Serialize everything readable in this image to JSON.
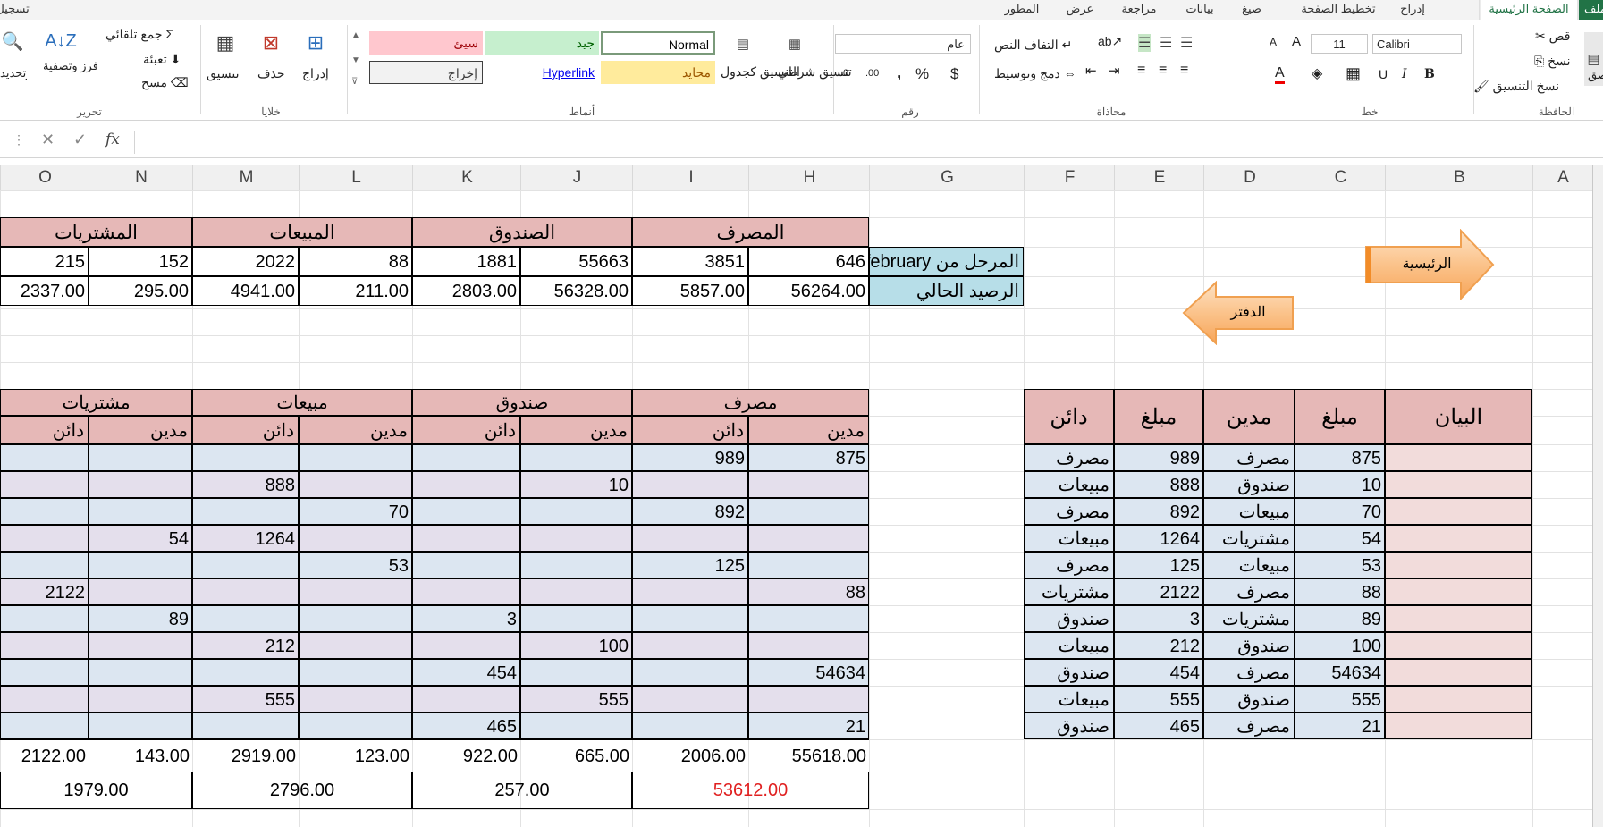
{
  "tabs": [
    "ملف",
    "الصفحة الرئيسية",
    "إدراج",
    "تخطيط الصفحة",
    "صيغ",
    "بيانات",
    "مراجعة",
    "عرض",
    "المطور",
    "تسجيل"
  ],
  "active_tab": "الصفحة الرئيسية",
  "ribbon": {
    "clipboard": {
      "group": "الحافظة",
      "cut": "قص",
      "copy": "نسخ",
      "format_painter": "نسخ التنسيق",
      "paste": "لصق"
    },
    "font": {
      "group": "خط",
      "name": "Calibri",
      "size": "11",
      "bold": "B",
      "italic": "I",
      "underline": "U"
    },
    "alignment": {
      "group": "محاذاة",
      "wrap": "التفاف النص",
      "merge": "دمج وتوسيط"
    },
    "number": {
      "group": "رقم",
      "format": "عام",
      "currency": "$",
      "percent": "%",
      "comma": ","
    },
    "styles": {
      "group": "أنماط",
      "conditional": "تنسيق شرطي",
      "as_table": "التنسيق كجدول",
      "normal": "Normal",
      "good": "جيد",
      "bad": "سيئ",
      "neutral": "محايد",
      "hyperlink": "Hyperlink",
      "output": "إخراج"
    },
    "cells": {
      "group": "خلايا",
      "insert": "إدراج",
      "delete": "حذف",
      "format": "تنسيق"
    },
    "editing": {
      "group": "تحرير",
      "autosum": "جمع تلقائي",
      "fill": "تعبئة",
      "clear": "مسح",
      "sort": "فرز وتصفية",
      "find": "بحث وتحديد"
    }
  },
  "formula_bar": {
    "fx": "fx",
    "content": ""
  },
  "columns": [
    "O",
    "N",
    "M",
    "L",
    "K",
    "J",
    "I",
    "H",
    "G",
    "F",
    "E",
    "D",
    "C",
    "B",
    "A"
  ],
  "shapes": {
    "main_arrow": "الرئيسية",
    "ledger_arrow": "الدفتر"
  },
  "summary": {
    "groups": [
      "المشتريات",
      "المبيعات",
      "الصندوق",
      "المصرف"
    ],
    "carried_label": "المرحل من february",
    "current_label": "الرصيد الحالي",
    "carried": [
      "215",
      "152",
      "2022",
      "88",
      "1881",
      "55663",
      "3851",
      "646"
    ],
    "current": [
      "2337.00",
      "295.00",
      "4941.00",
      "211.00",
      "2803.00",
      "56328.00",
      "5857.00",
      "56264.00"
    ]
  },
  "ledger": {
    "groups": [
      "مشتريات",
      "مبيعات",
      "صندوق",
      "مصرف"
    ],
    "subheaders": [
      "دائن",
      "مدين",
      "دائن",
      "مدين",
      "دائن",
      "مدين",
      "دائن",
      "مدين"
    ],
    "rows": [
      [
        "",
        "",
        "",
        "",
        "",
        "",
        "989",
        "875"
      ],
      [
        "",
        "",
        "888",
        "",
        "",
        "10",
        "",
        ""
      ],
      [
        "",
        "",
        "",
        "70",
        "",
        "",
        "892",
        ""
      ],
      [
        "",
        "54",
        "1264",
        "",
        "",
        "",
        "",
        ""
      ],
      [
        "",
        "",
        "",
        "53",
        "",
        "",
        "125",
        ""
      ],
      [
        "2122",
        "",
        "",
        "",
        "",
        "",
        "",
        "88"
      ],
      [
        "",
        "89",
        "",
        "",
        "3",
        "",
        "",
        ""
      ],
      [
        "",
        "",
        "212",
        "",
        "",
        "100",
        "",
        ""
      ],
      [
        "",
        "",
        "",
        "",
        "454",
        "",
        "",
        "54634"
      ],
      [
        "",
        "",
        "555",
        "",
        "",
        "555",
        "",
        ""
      ],
      [
        "",
        "",
        "",
        "",
        "465",
        "",
        "",
        "21"
      ]
    ],
    "totals": [
      "2122.00",
      "143.00",
      "2919.00",
      "123.00",
      "922.00",
      "665.00",
      "2006.00",
      "55618.00"
    ],
    "balances": [
      "1979.00",
      "2796.00",
      "257.00",
      "53612.00"
    ],
    "negative_color": "#e02020"
  },
  "journal": {
    "headers": [
      "دائن",
      "مبلغ",
      "مدين",
      "مبلغ",
      "البيان"
    ],
    "rows": [
      [
        "مصرف",
        "989",
        "مصرف",
        "875",
        ""
      ],
      [
        "مبيعات",
        "888",
        "صندوق",
        "10",
        ""
      ],
      [
        "مصرف",
        "892",
        "مبيعات",
        "70",
        ""
      ],
      [
        "مبيعات",
        "1264",
        "مشتريات",
        "54",
        ""
      ],
      [
        "مصرف",
        "125",
        "مبيعات",
        "53",
        ""
      ],
      [
        "مشتريات",
        "2122",
        "مصرف",
        "88",
        ""
      ],
      [
        "صندوق",
        "3",
        "مشتريات",
        "89",
        ""
      ],
      [
        "مبيعات",
        "212",
        "صندوق",
        "100",
        ""
      ],
      [
        "صندوق",
        "454",
        "مصرف",
        "54634",
        ""
      ],
      [
        "مبيعات",
        "555",
        "صندوق",
        "555",
        ""
      ],
      [
        "صندوق",
        "465",
        "مصرف",
        "21",
        ""
      ]
    ]
  },
  "colors": {
    "header_pink": "#e6b8b7",
    "light_pink": "#f2dcdb",
    "light_blue": "#dce6f1",
    "light_lavender": "#e4dfec",
    "label_blue": "#b7dee8",
    "excel_green": "#217346"
  }
}
